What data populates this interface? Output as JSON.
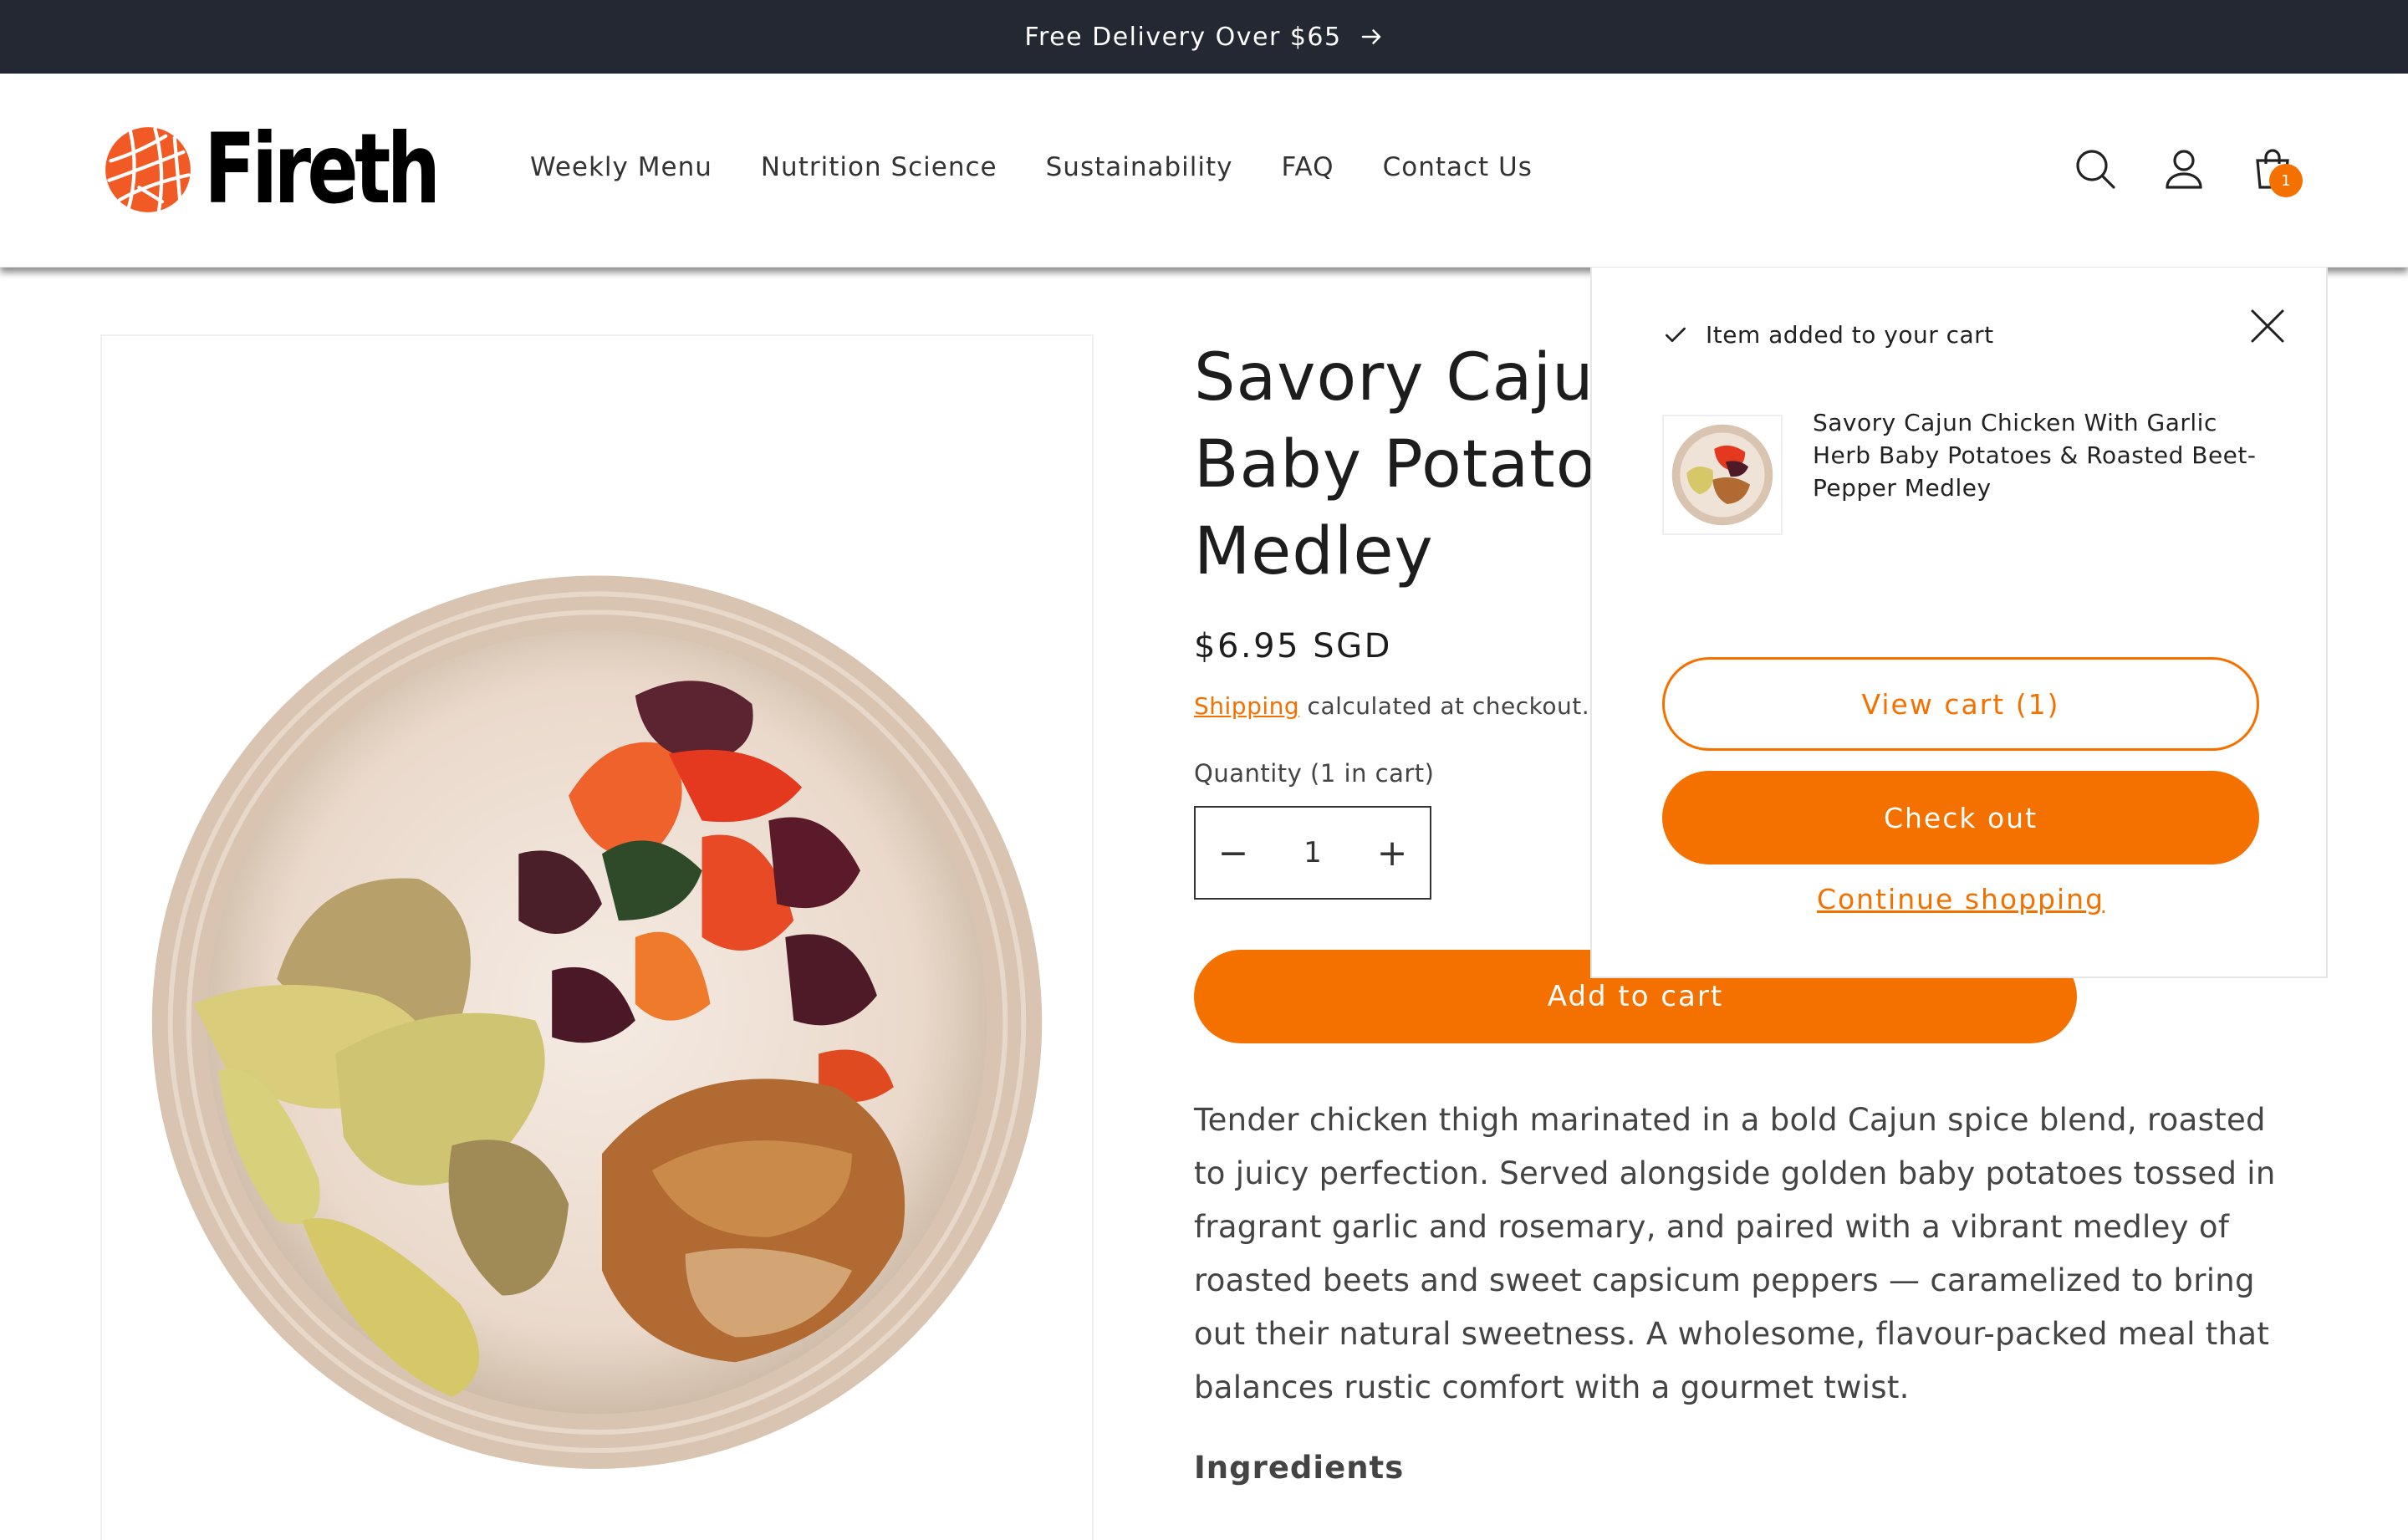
{
  "announcement": {
    "text": "Free Delivery Over $65"
  },
  "brand": {
    "name": "Fireth",
    "accent": "#f47100",
    "dark": "#232833"
  },
  "nav": [
    {
      "label": "Weekly Menu"
    },
    {
      "label": "Nutrition Science"
    },
    {
      "label": "Sustainability"
    },
    {
      "label": "FAQ"
    },
    {
      "label": "Contact Us"
    }
  ],
  "header_icons": {
    "search": "search-icon",
    "account": "account-icon",
    "cart": "cart-icon",
    "cart_count": "1"
  },
  "product": {
    "title": "Savory Cajun Chicken With Garlic Herb Baby Potatoes & Roasted Beet-Pepper Medley",
    "title_visible_lines": [
      "Savory Cajun",
      "Baby Potatoes",
      "Medley"
    ],
    "price": "$6.95 SGD",
    "shipping_link": "Shipping",
    "shipping_text": " calculated at checkout.",
    "quantity_label": "Quantity (1 in cart)",
    "quantity": "1",
    "decrement": "−",
    "increment": "+",
    "add_to_cart": "Add to cart",
    "description": "Tender chicken thigh marinated in a bold Cajun spice blend, roasted to juicy perfection. Served alongside golden baby potatoes tossed in fragrant garlic and rosemary, and paired with a vibrant medley of roasted beets and sweet capsicum peppers — caramelized to bring out their natural sweetness. A wholesome, flavour-packed meal that balances rustic comfort with a gourmet twist.",
    "ingredients_heading": "Ingredients"
  },
  "cart_notification": {
    "heading": "Item added to your cart",
    "item_name": "Savory Cajun Chicken With Garlic Herb Baby Potatoes & Roasted Beet-Pepper Medley",
    "view_cart": "View cart (1)",
    "checkout": "Check out",
    "continue": "Continue shopping"
  }
}
